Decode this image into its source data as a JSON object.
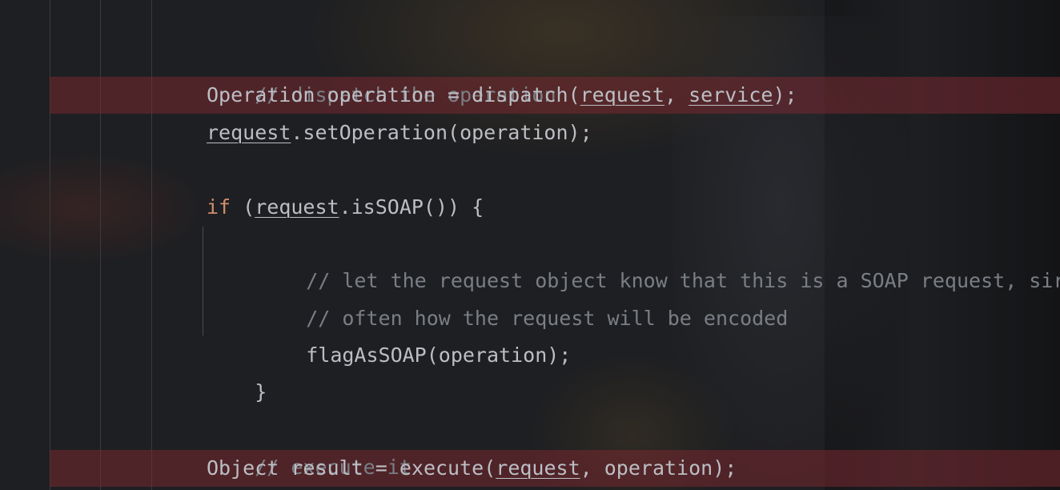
{
  "editor": {
    "lines": [
      {
        "comment": "// dispatch the operation"
      },
      {
        "type_name": "Operation",
        "var_name": "operation",
        "eq": " = ",
        "call": "dispatch(",
        "arg1": "request",
        "sep": ", ",
        "arg2": "service",
        "end": ");"
      },
      {
        "obj": "request",
        "rest": ".setOperation(operation);"
      },
      {
        "keyword": "if",
        "open": " (",
        "obj": "request",
        "rest": ".isSOAP()) {"
      },
      {
        "comment": "// let the request object know that this is a SOAP request, sir"
      },
      {
        "comment": "// often how the request will be encoded"
      },
      {
        "code": "flagAsSOAP(operation);"
      },
      {
        "code": "}"
      },
      {
        "comment": "// execute it"
      },
      {
        "type_name": "Object",
        "var_name": "result",
        "eq": " = ",
        "call": "execute(",
        "arg1": "request",
        "sep": ", ",
        "arg2": "operation",
        "end": ");"
      }
    ]
  },
  "theme": {
    "background": "#1e1f22",
    "comment_color": "#7a7e85",
    "keyword_color": "#cf8e6d",
    "text_color": "#bcbec4",
    "highlight_color": "#782830"
  }
}
